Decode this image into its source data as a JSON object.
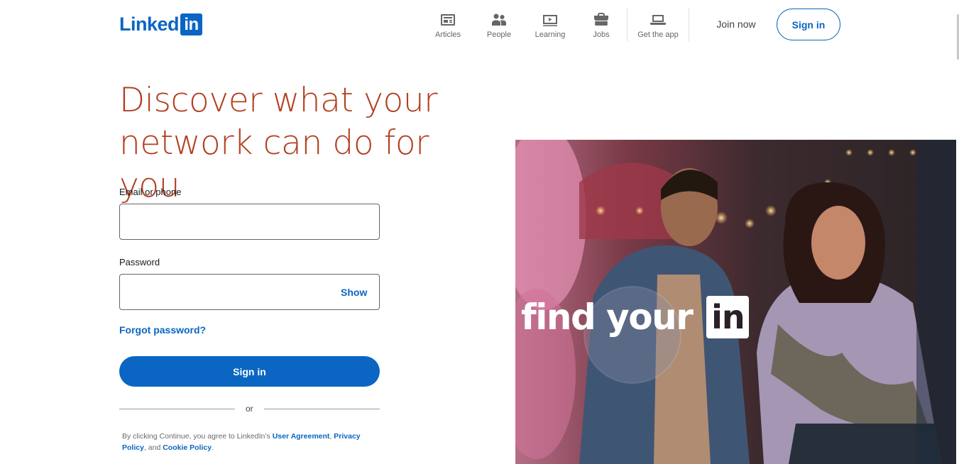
{
  "header": {
    "logo": {
      "text": "Linked",
      "box": "in"
    },
    "nav": [
      {
        "label": "Articles",
        "icon": "articles-icon"
      },
      {
        "label": "People",
        "icon": "people-icon"
      },
      {
        "label": "Learning",
        "icon": "learning-icon"
      },
      {
        "label": "Jobs",
        "icon": "jobs-icon"
      },
      {
        "label": "Get the app",
        "icon": "laptop-icon"
      }
    ],
    "join_label": "Join now",
    "signin_label": "Sign in"
  },
  "main": {
    "headline": "Discover what your network can do for you",
    "email_label": "Email or phone",
    "email_value": "",
    "password_label": "Password",
    "password_value": "",
    "show_label": "Show",
    "forgot_label": "Forgot password?",
    "signin_label": "Sign in",
    "or_label": "or",
    "terms": {
      "prefix": "By clicking Continue, you agree to LinkedIn’s ",
      "user_agreement": "User Agreement",
      "sep1": ", ",
      "privacy": "Privacy Policy",
      "sep2": ", and ",
      "cookie": "Cookie Policy",
      "suffix": "."
    }
  },
  "hero": {
    "text": "find your",
    "box": "in"
  },
  "colors": {
    "brand": "#0a66c2",
    "headline": "#b24020"
  }
}
